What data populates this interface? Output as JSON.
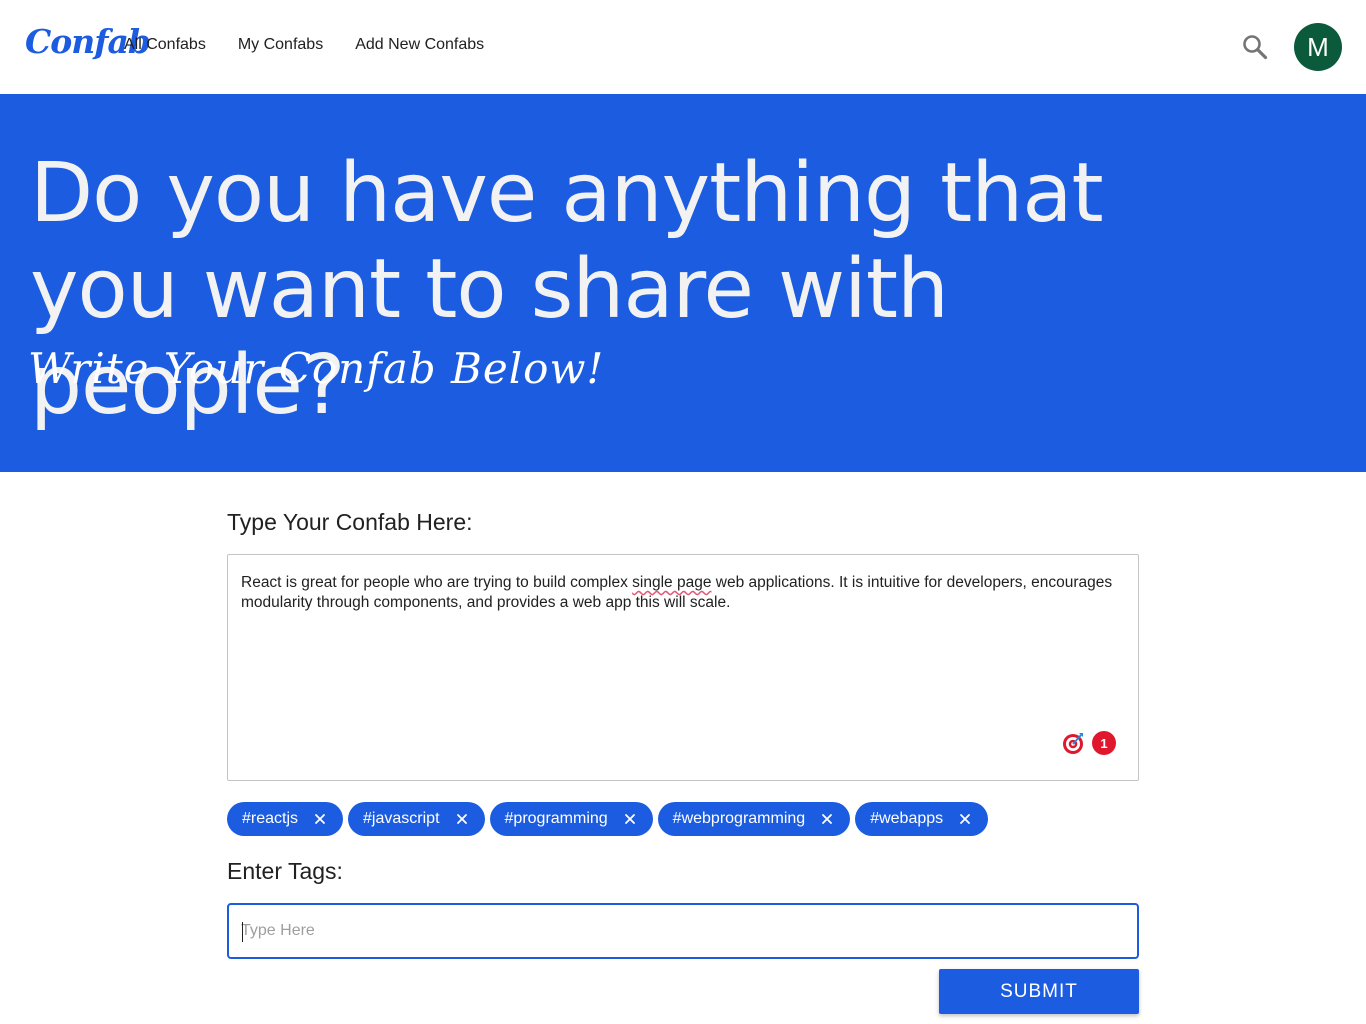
{
  "header": {
    "logo": "Confab",
    "nav": [
      "All Confabs",
      "My Confabs",
      "Add New Confabs"
    ],
    "search_icon": "search-icon",
    "avatar_initial": "M",
    "avatar_color": "#0b5a3b"
  },
  "hero": {
    "title": "Do you have anything that you want to share with people?",
    "subtitle": "Write Your Confab Below!",
    "background": "#1b5ce0"
  },
  "form": {
    "confab_label": "Type Your Confab Here:",
    "confab_text_before": "React is great for people who are trying to build complex ",
    "confab_text_flagged": "single page",
    "confab_text_after": " web applications. It is intuitive for developers, encourages modularity through components, and provides a web app this will scale.",
    "widget_icon": "target-icon",
    "widget_count": "1",
    "tags": [
      "#reactjs",
      "#javascript",
      "#programming",
      "#webprogramming",
      "#webapps"
    ],
    "tags_label": "Enter Tags:",
    "tag_input_value": "",
    "tag_input_placeholder": "Type Here",
    "submit_label": "SUBMIT"
  },
  "colors": {
    "accent": "#1b5ce0",
    "badge": "#e0182d"
  }
}
